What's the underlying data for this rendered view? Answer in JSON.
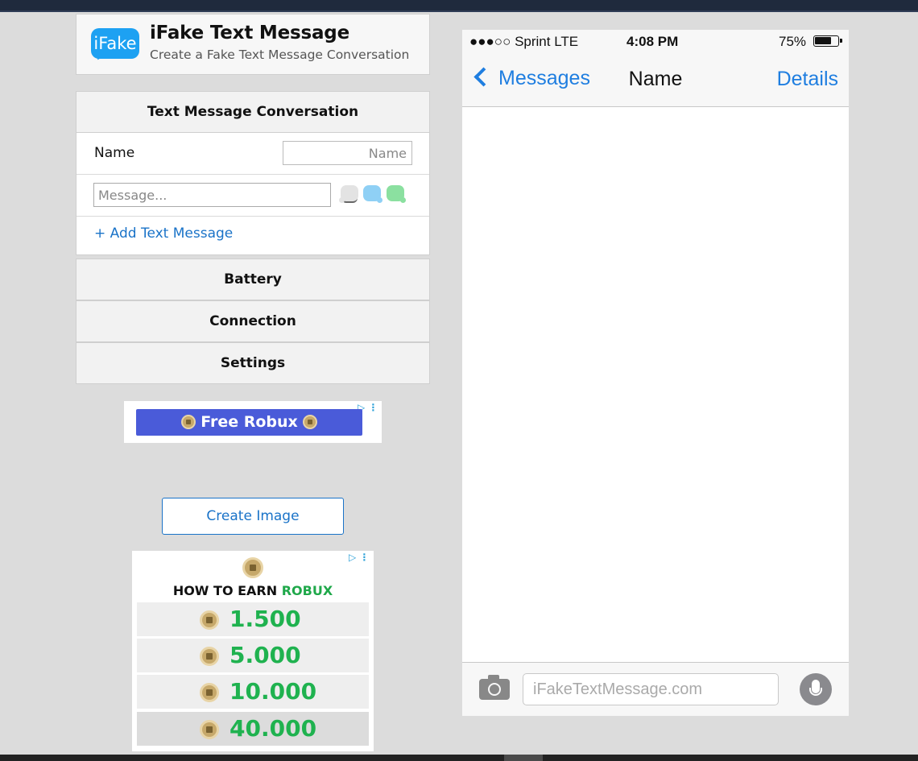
{
  "brand": {
    "logo_text": "iFake",
    "title": "iFake Text Message",
    "subtitle": "Create a Fake Text Message Conversation"
  },
  "conversation_panel": {
    "heading": "Text Message Conversation",
    "name_label": "Name",
    "name_placeholder": "Name",
    "message_placeholder": "Message...",
    "add_message_label": "+ Add Text Message"
  },
  "sections": {
    "battery": "Battery",
    "connection": "Connection",
    "settings": "Settings"
  },
  "ad_top": {
    "button_label": "Free Robux",
    "adchoice": "▷ ⋮"
  },
  "create_button_label": "Create Image",
  "ad_bottom": {
    "headline_prefix": "HOW TO EARN",
    "headline_highlight": "ROBUX",
    "adchoice": "▷ ⋮",
    "tiers": [
      "1.500",
      "5.000",
      "10.000",
      "40.000"
    ]
  },
  "phone": {
    "status": {
      "carrier": "●●●○○ Sprint  LTE",
      "time": "4:08 PM",
      "battery_percent": "75%",
      "battery_level": 0.75
    },
    "nav": {
      "back_label": "Messages",
      "title": "Name",
      "details_label": "Details"
    },
    "composer_placeholder": "iFakeTextMessage.com"
  },
  "colors": {
    "ios_blue": "#1f7ee0",
    "link_blue": "#1a73c8",
    "bubble_blue": "#8fd0f5",
    "bubble_green": "#8be0a0",
    "robux_green": "#1fb24f"
  }
}
